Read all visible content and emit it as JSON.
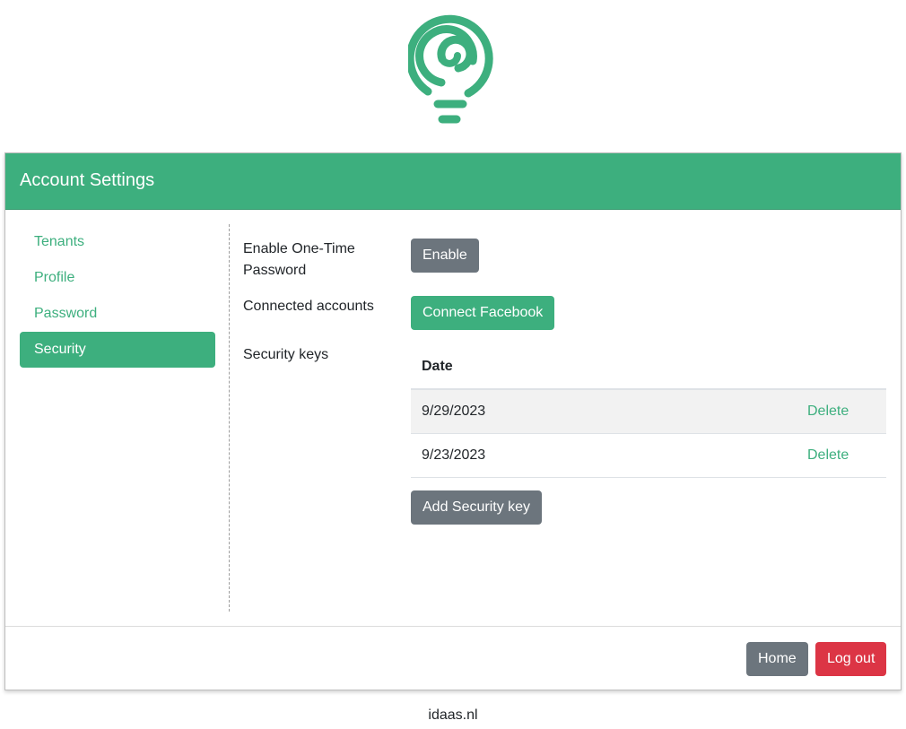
{
  "logo": {
    "icon": "spiral-lightbulb-icon",
    "color": "#3daf7e"
  },
  "header": {
    "title": "Account Settings"
  },
  "sidebar": {
    "items": [
      {
        "label": "Tenants",
        "active": false
      },
      {
        "label": "Profile",
        "active": false
      },
      {
        "label": "Password",
        "active": false
      },
      {
        "label": "Security",
        "active": true
      }
    ]
  },
  "security": {
    "otp_label": "Enable One-Time Password",
    "otp_button": "Enable",
    "connected_label": "Connected accounts",
    "connect_button": "Connect Facebook",
    "keys_label": "Security keys",
    "keys_table": {
      "header": "Date",
      "rows": [
        {
          "date": "9/29/2023",
          "action": "Delete"
        },
        {
          "date": "9/23/2023",
          "action": "Delete"
        }
      ]
    },
    "add_key_button": "Add Security key"
  },
  "footer": {
    "home_button": "Home",
    "logout_button": "Log out"
  },
  "site": {
    "domain": "idaas.nl"
  },
  "colors": {
    "accent": "#3daf7e",
    "secondary": "#6c757d",
    "danger": "#dc3545"
  }
}
